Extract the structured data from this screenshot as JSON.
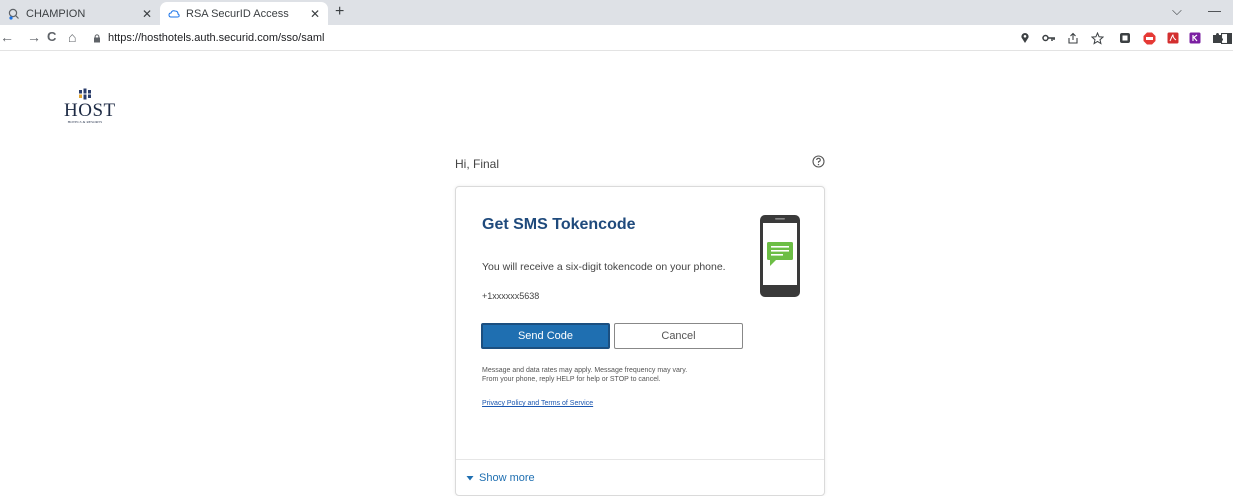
{
  "browser": {
    "tabs": [
      {
        "title": "CHAMPION",
        "close": "✕",
        "active": false
      },
      {
        "title": "RSA SecurID Access",
        "close": "✕",
        "active": true
      }
    ],
    "new_tab": "+",
    "window_controls": {
      "collapse": "⌵",
      "minimize": "—"
    },
    "nav": {
      "back": "←",
      "forward": "→",
      "reload": "C",
      "home": "⌂"
    },
    "url": "https://hosthotels.auth.securid.com/sso/saml",
    "toolbar_icons": [
      "location-icon",
      "key-icon",
      "share-icon",
      "star-icon",
      "extension-g-icon",
      "adblock-icon",
      "pdf-icon",
      "extension-k-icon",
      "puzzle-icon",
      "sidebar-icon"
    ]
  },
  "logo": {
    "word": "HOST",
    "sub": "HOTELS & RESORTS"
  },
  "greeting": "Hi, Final",
  "card": {
    "title": "Get SMS Tokencode",
    "description": "You will receive a six-digit tokencode on your phone.",
    "phone_number": "+1xxxxxx5638",
    "send_label": "Send Code",
    "cancel_label": "Cancel",
    "notice_line1": "Message and data rates may apply. Message frequency may vary.",
    "notice_line2": "From your phone, reply HELP for help or STOP to cancel.",
    "privacy_link": "Privacy Policy and Terms of Service",
    "show_more": "Show more"
  },
  "colors": {
    "accent": "#1f6fb1",
    "title": "#1f4a7c",
    "sms_green": "#6cbe45"
  }
}
